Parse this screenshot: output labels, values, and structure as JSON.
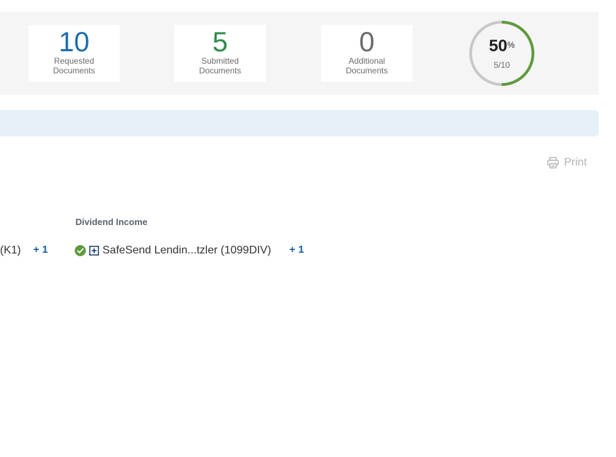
{
  "stats": {
    "requested": {
      "count": "10",
      "label_line1": "Requested",
      "label_line2": "Documents",
      "color": "#1a6fb0"
    },
    "submitted": {
      "count": "5",
      "label_line1": "Submitted",
      "label_line2": "Documents",
      "color": "#2e8a4e"
    },
    "additional": {
      "count": "0",
      "label_line1": "Additional",
      "label_line2": "Documents",
      "color": "#6b6b6b"
    }
  },
  "progress": {
    "percent": "50",
    "percent_sign": "%",
    "fraction": "5/10",
    "value": 0.5,
    "track_color": "#c8c8c8",
    "fill_color": "#5f9a3d"
  },
  "print": {
    "label": "Print",
    "icon": "printer-icon"
  },
  "category": {
    "title": "Dividend Income"
  },
  "documents": {
    "partial_row": {
      "text": "(K1)",
      "more": "+ 1"
    },
    "dividend_row": {
      "status_icon": "check-circle-icon",
      "status_color": "#5f9a3d",
      "expand_icon": "plus-square-icon",
      "text": "SafeSend Lendin...tzler (1099DIV)",
      "more": "+ 1"
    }
  }
}
